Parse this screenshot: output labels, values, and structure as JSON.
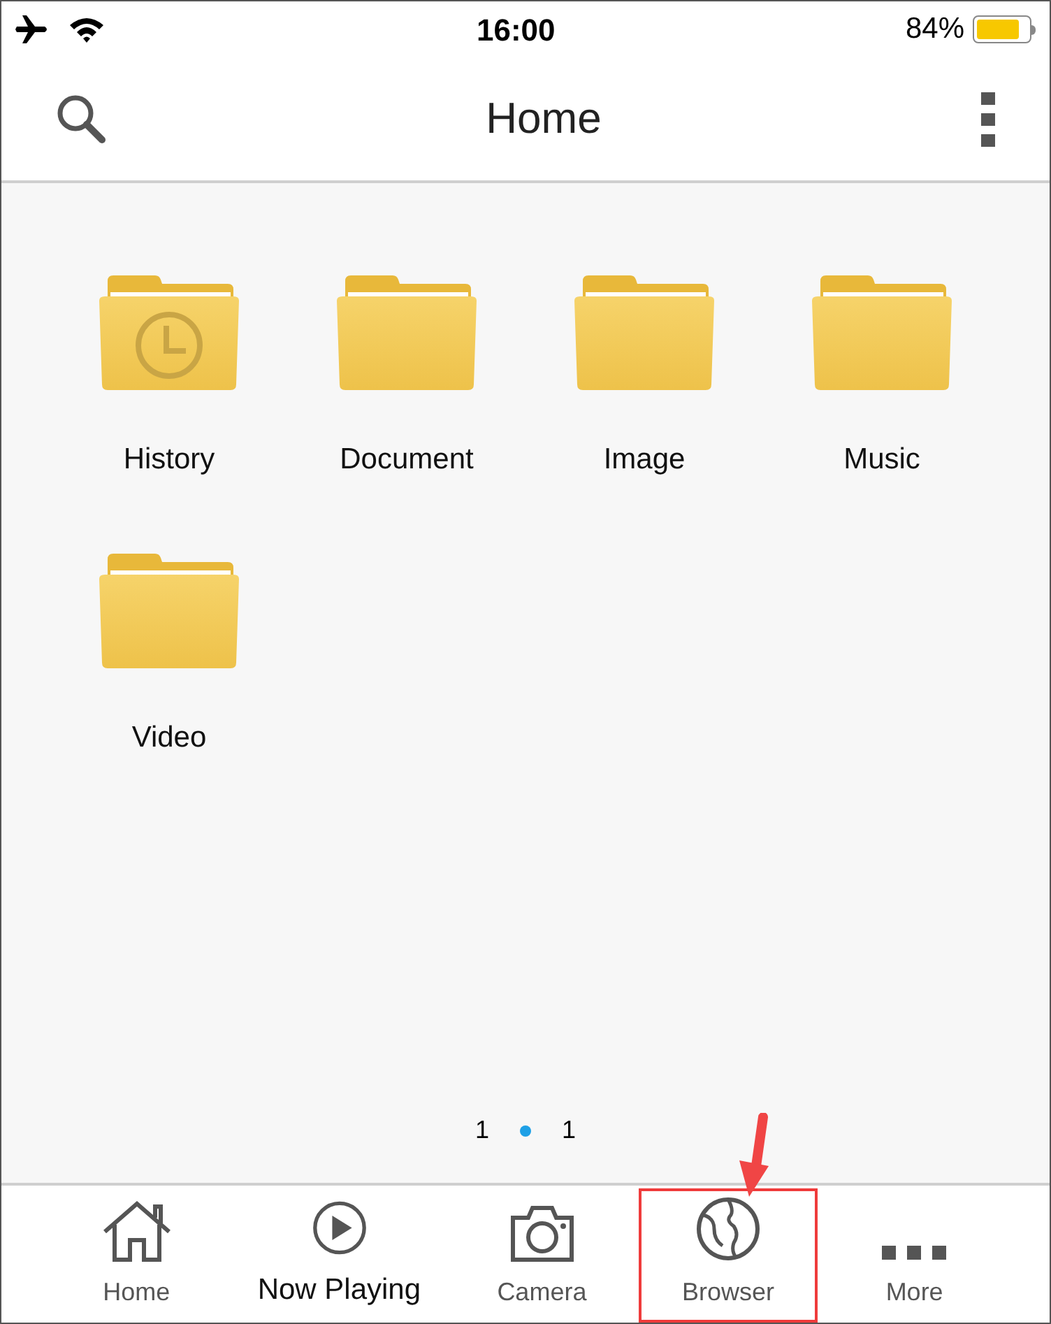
{
  "status_bar": {
    "airplane_mode": true,
    "time": "16:00",
    "battery_percent": "84%",
    "battery": {
      "level": 0.84
    }
  },
  "header": {
    "title": "Home"
  },
  "folders": [
    {
      "label": "History",
      "kind": "history"
    },
    {
      "label": "Document",
      "kind": "plain"
    },
    {
      "label": "Image",
      "kind": "plain"
    },
    {
      "label": "Music",
      "kind": "plain"
    },
    {
      "label": "Video",
      "kind": "plain"
    }
  ],
  "pager": {
    "current": "1",
    "total": "1"
  },
  "tabs": [
    {
      "label": "Home",
      "kind": "home",
      "selected": false,
      "highlighted": false
    },
    {
      "label": "Now Playing",
      "kind": "play",
      "selected": true,
      "highlighted": false
    },
    {
      "label": "Camera",
      "kind": "camera",
      "selected": false,
      "highlighted": false
    },
    {
      "label": "Browser",
      "kind": "globe",
      "selected": false,
      "highlighted": true
    },
    {
      "label": "More",
      "kind": "more",
      "selected": false,
      "highlighted": false
    }
  ]
}
